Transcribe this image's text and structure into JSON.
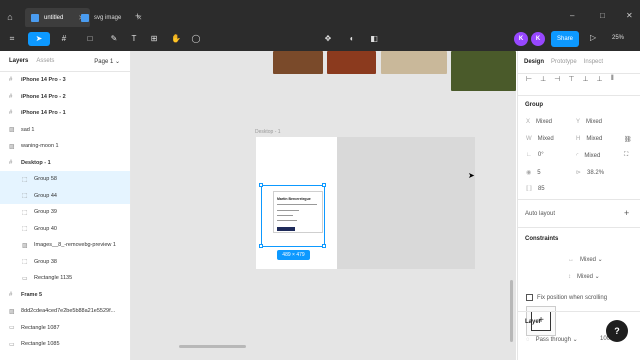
{
  "titlebar": {
    "tabs": [
      {
        "label": "untitled"
      },
      {
        "label": "svg image"
      }
    ],
    "add_label": "+",
    "window_controls": [
      "–",
      "□",
      "✕"
    ]
  },
  "toolbar": {
    "avatars": [
      "K",
      "K"
    ],
    "share_label": "Share",
    "zoom_label": "25%"
  },
  "left_panel": {
    "tab_layers": "Layers",
    "tab_assets": "Assets",
    "page_label": "Page 1",
    "layers": [
      {
        "label": "iPhone 14 Pro - 3",
        "kind": "frame"
      },
      {
        "label": "iPhone 14 Pro - 2",
        "kind": "frame"
      },
      {
        "label": "iPhone 14 Pro - 1",
        "kind": "frame"
      },
      {
        "label": "sad 1",
        "kind": "image"
      },
      {
        "label": "waning-moon 1",
        "kind": "image"
      },
      {
        "label": "Desktop - 1",
        "kind": "frame"
      },
      {
        "label": "Group 58",
        "kind": "group",
        "highlight": true
      },
      {
        "label": "Group 44",
        "kind": "group",
        "highlight": true
      },
      {
        "label": "Group 39",
        "kind": "group"
      },
      {
        "label": "Group 40",
        "kind": "group"
      },
      {
        "label": "Images__8_-removebg-preview 1",
        "kind": "image"
      },
      {
        "label": "Group 38",
        "kind": "group"
      },
      {
        "label": "Rectangle 1135",
        "kind": "rect"
      },
      {
        "label": "Frame 5",
        "kind": "frame"
      },
      {
        "label": "8dd2cdea4ced7e2be5b88a21e5529f...",
        "kind": "image"
      },
      {
        "label": "Rectangle 1087",
        "kind": "rect"
      },
      {
        "label": "Rectangle 1085",
        "kind": "rect"
      }
    ]
  },
  "canvas": {
    "frame_label": "Desktop - 1",
    "dimension_badge": "489 × 479",
    "mini_title": "Martin Bercerelegue"
  },
  "right_panel": {
    "tab_design": "Design",
    "tab_prototype": "Prototype",
    "tab_inspect": "Inspect",
    "group_heading": "Group",
    "fields": {
      "x_label": "X",
      "x_value": "Mixed",
      "y_label": "Y",
      "y_value": "Mixed",
      "w_label": "W",
      "w_value": "Mixed",
      "h_label": "H",
      "h_value": "Mixed",
      "rotation_label": "∟",
      "rotation_value": "0°",
      "radius_label": "◜",
      "radius_value": "Mixed",
      "count_label": "◉",
      "count_value": "5",
      "percent_label": "⊳",
      "percent_value": "38.2%",
      "size_label": "⟦⟧",
      "size_value": "85"
    },
    "auto_layout": "Auto layout",
    "constraints": "Constraints",
    "constraint_h": "Mixed",
    "constraint_v": "Mixed",
    "fix_position": "Fix position when scrolling",
    "layer_heading": "Layer",
    "blend_mode": "Pass through",
    "opacity": "100%"
  },
  "colors": {
    "accent": "#0d99ff",
    "titlebar": "#2c2c2c",
    "avatar": "#9747ff"
  }
}
